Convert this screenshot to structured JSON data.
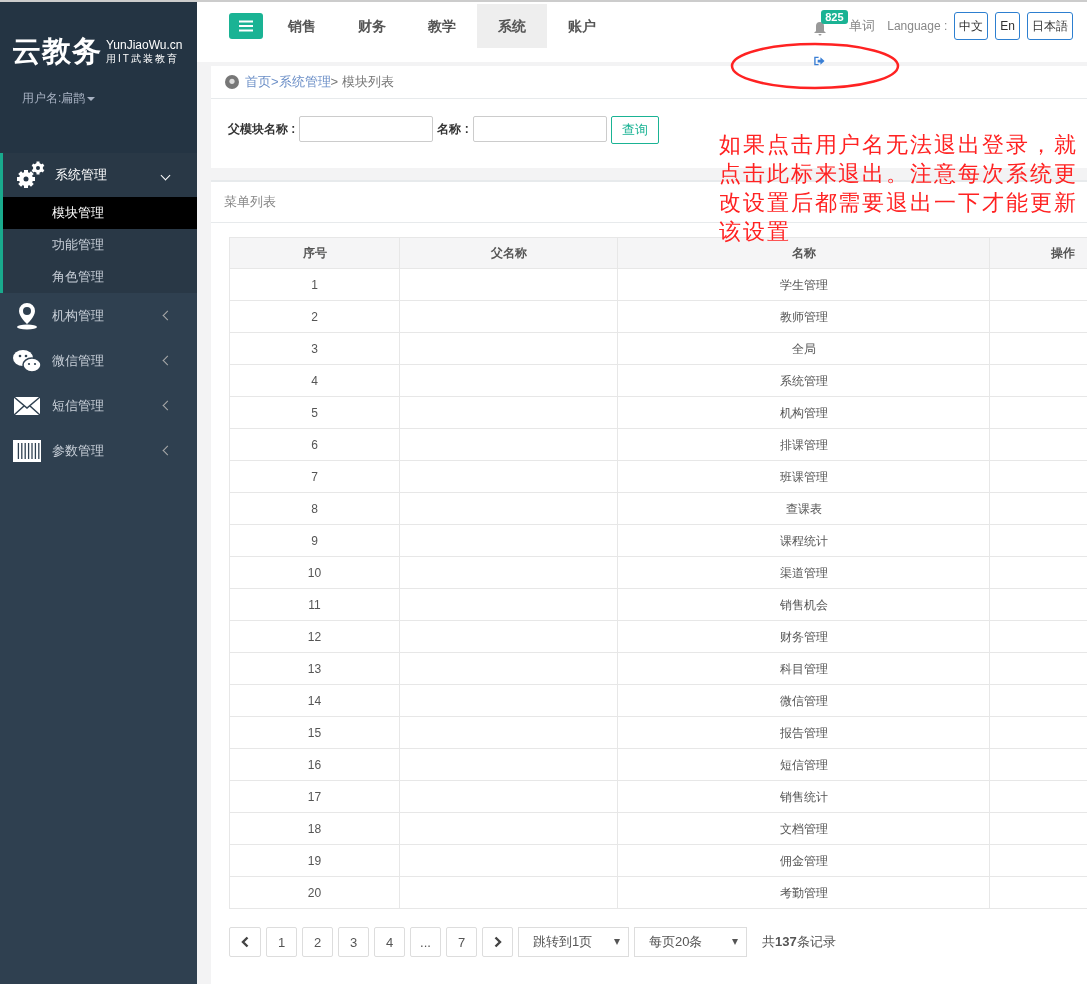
{
  "sidebar": {
    "logo": {
      "title": "云教务",
      "domain": "YunJiaoWu.cn",
      "slogan": "用IT武装教育"
    },
    "user": "用户名:扁鹊",
    "items": [
      {
        "label": "系统管理",
        "kind": "gear",
        "expanded": true,
        "children": [
          {
            "label": "模块管理",
            "selected": true
          },
          {
            "label": "功能管理",
            "selected": false
          },
          {
            "label": "角色管理",
            "selected": false
          }
        ]
      },
      {
        "label": "机构管理",
        "kind": "pin",
        "expanded": false
      },
      {
        "label": "微信管理",
        "kind": "chat",
        "expanded": false
      },
      {
        "label": "短信管理",
        "kind": "mail",
        "expanded": false
      },
      {
        "label": "参数管理",
        "kind": "sliders",
        "expanded": false
      }
    ]
  },
  "topbar": {
    "tabs": [
      {
        "label": "销售",
        "selected": false
      },
      {
        "label": "财务",
        "selected": false
      },
      {
        "label": "教学",
        "selected": false
      },
      {
        "label": "系统",
        "selected": true
      },
      {
        "label": "账户",
        "selected": false
      }
    ],
    "notification_count": "825",
    "word_link": "单词",
    "language_label": "Language :",
    "languages": [
      "中文",
      "En",
      "日本語"
    ]
  },
  "breadcrumb": [
    {
      "label": "首页",
      "link": true
    },
    {
      "label": ">系统管理",
      "link": true
    },
    {
      "label": "> 模块列表",
      "link": false
    }
  ],
  "search": {
    "fields": [
      {
        "label": "父模块名称 :"
      },
      {
        "label": "名称 :"
      }
    ],
    "button": "查询"
  },
  "panel_title": "菜单列表",
  "table": {
    "columns": [
      "序号",
      "父名称",
      "名称",
      "操作"
    ],
    "rows": [
      [
        "1",
        "",
        "学生管理"
      ],
      [
        "2",
        "",
        "教师管理"
      ],
      [
        "3",
        "",
        "全局"
      ],
      [
        "4",
        "",
        "系统管理"
      ],
      [
        "5",
        "",
        "机构管理"
      ],
      [
        "6",
        "",
        "排课管理"
      ],
      [
        "7",
        "",
        "班课管理"
      ],
      [
        "8",
        "",
        "查课表"
      ],
      [
        "9",
        "",
        "课程统计"
      ],
      [
        "10",
        "",
        "渠道管理"
      ],
      [
        "11",
        "",
        "销售机会"
      ],
      [
        "12",
        "",
        "财务管理"
      ],
      [
        "13",
        "",
        "科目管理"
      ],
      [
        "14",
        "",
        "微信管理"
      ],
      [
        "15",
        "",
        "报告管理"
      ],
      [
        "16",
        "",
        "短信管理"
      ],
      [
        "17",
        "",
        "销售统计"
      ],
      [
        "18",
        "",
        "文档管理"
      ],
      [
        "19",
        "",
        "佣金管理"
      ],
      [
        "20",
        "",
        "考勤管理"
      ]
    ]
  },
  "pagination": {
    "pages": [
      "1",
      "2",
      "3",
      "4",
      "...",
      "7"
    ],
    "jump": "跳转到1页",
    "per_page": "每页20条",
    "total": "共**137**条记录"
  },
  "annotation": "如果点击用户名无法退出登录，就点击此标来退出。注意每次系统更改设置后都需要退出一下才能更新该设置"
}
